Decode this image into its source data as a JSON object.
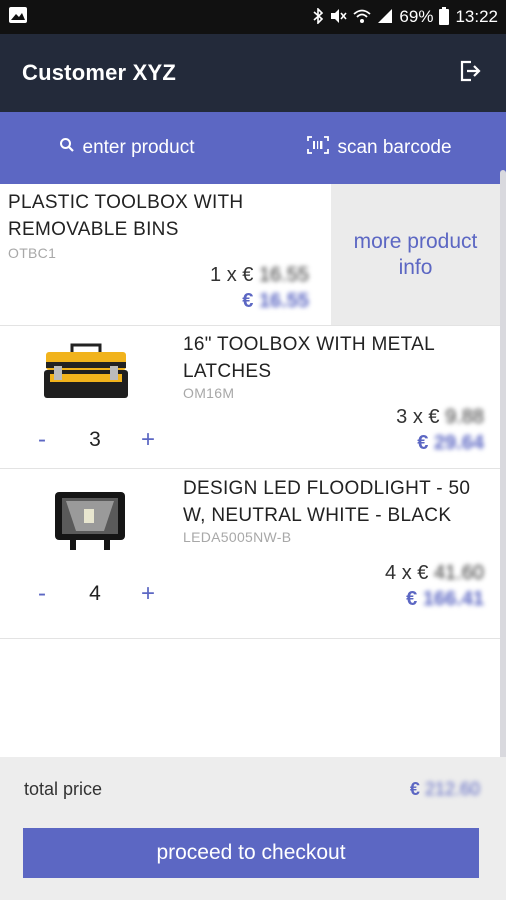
{
  "status_bar": {
    "battery": "69%",
    "time": "13:22",
    "icons": [
      "image-icon",
      "bluetooth-icon",
      "mute-icon",
      "wifi-icon",
      "signal-icon",
      "battery-icon"
    ]
  },
  "header": {
    "title": "Customer XYZ",
    "logout_icon": "logout-icon"
  },
  "actions": {
    "enter_product": "enter product",
    "scan_barcode": "scan barcode"
  },
  "items": [
    {
      "name": "PLASTIC TOOLBOX WITH REMOVABLE BINS",
      "code": "OTBC1",
      "qty_prefix": "1 x €",
      "unit_price": "16.55",
      "currency": "€",
      "total": "16.55",
      "more_info": "more product info"
    },
    {
      "name": "16\" TOOLBOX WITH METAL LATCHES",
      "code": "OM16M",
      "qty_prefix": "3 x €",
      "unit_price": "9.88",
      "currency": "€",
      "total": "29.64",
      "quantity": "3",
      "minus": "-",
      "plus": "+"
    },
    {
      "name": "DESIGN LED FLOODLIGHT - 50 W, NEUTRAL WHITE - BLACK",
      "code": "LEDA5005NW-B",
      "qty_prefix": "4 x €",
      "unit_price": "41.60",
      "currency": "€",
      "total": "166.41",
      "quantity": "4",
      "minus": "-",
      "plus": "+"
    }
  ],
  "footer": {
    "total_label": "total price",
    "currency": "€",
    "total_value": "212.60",
    "checkout_label": "proceed to checkout"
  },
  "colors": {
    "accent": "#5c67c3",
    "header_bg": "#232a3a",
    "status_bg": "#111111"
  }
}
